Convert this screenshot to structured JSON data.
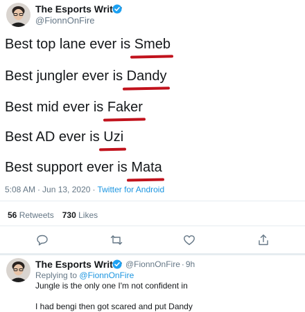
{
  "main_tweet": {
    "author": {
      "name": "The Esports Writer",
      "handle": "@FionnOnFire",
      "verified": true
    },
    "lines": [
      {
        "prefix": "Best top lane ever is ",
        "player": "Smeb"
      },
      {
        "prefix": "Best jungler ever is ",
        "player": "Dandy"
      },
      {
        "prefix": "Best mid ever is ",
        "player": "Faker"
      },
      {
        "prefix": "Best AD ever is ",
        "player": "Uzi"
      },
      {
        "prefix": "Best support ever is ",
        "player": "Mata"
      }
    ],
    "time": "5:08 AM",
    "date": "Jun 13, 2020",
    "separator": "·",
    "source": "Twitter for Android",
    "stats": {
      "retweets_count": "56",
      "retweets_label": "Retweets",
      "likes_count": "730",
      "likes_label": "Likes"
    },
    "actions": [
      "reply-icon",
      "retweet-icon",
      "like-icon",
      "share-icon"
    ]
  },
  "reply_tweet": {
    "author": {
      "name": "The Esports Writer",
      "handle": "@FionnOnFire",
      "verified": true
    },
    "separator": "·",
    "time_ago": "9h",
    "replying_to_label": "Replying to",
    "replying_to_handle": "@FionnOnFire",
    "text_lines": [
      "Jungle is the only one I'm not confident in",
      "I had bengi then got scared and put Dandy"
    ]
  },
  "colors": {
    "text": "#14171a",
    "muted": "#657786",
    "link": "#1b95e0",
    "underline": "#c1121c",
    "verified": "#1da1f2",
    "divider": "#e6ecf0"
  }
}
